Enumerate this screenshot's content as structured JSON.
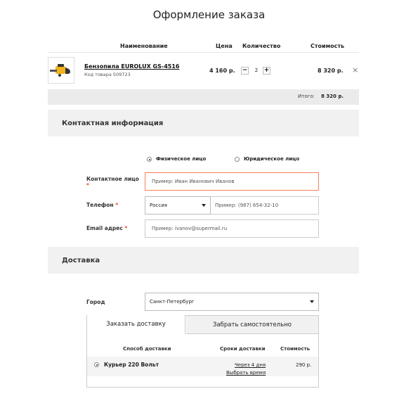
{
  "page": {
    "title": "Оформление заказа"
  },
  "cart": {
    "headers": {
      "name": "Наименование",
      "price": "Цена",
      "qty": "Количество",
      "cost": "Стоимость"
    },
    "items": [
      {
        "name": "Бензопила EUROLUX GS-4516",
        "code": "Код товара 509723",
        "price": "4 160 р.",
        "qty_minus": "−",
        "qty": "2",
        "qty_plus": "+",
        "total": "8 320 р.",
        "remove": "×"
      }
    ],
    "total_label": "Итого:",
    "total_value": "8 320 р."
  },
  "contact": {
    "title": "Контактная информация",
    "person_type": {
      "individual": "Физическое лицо",
      "legal": "Юридическое лицо",
      "selected": "individual"
    },
    "contact_person": {
      "label": "Контактное лицо",
      "req": "*",
      "placeholder": "Пример: Иван Иванович Иванов"
    },
    "phone": {
      "label": "Телефон",
      "req": "*",
      "country": "Россия",
      "placeholder": "Пример: (987) 654-32-10"
    },
    "email": {
      "label": "Email адрес",
      "req": "*",
      "placeholder": "Пример: ivanov@supermail.ru"
    }
  },
  "delivery": {
    "title": "Доставка",
    "city_label": "Город",
    "city_value": "Санкт-Петербург",
    "tabs": {
      "order_delivery": "Заказать доставку",
      "pickup": "Забрать самостоятельно",
      "active": "order_delivery"
    },
    "table_headers": {
      "method": "Способ доставки",
      "term": "Сроки доставки",
      "cost": "Стоимость"
    },
    "options": [
      {
        "name": "Курьер 220 Вольт",
        "term": "Через 4 дня",
        "choose_time": "Выбрать время",
        "cost": "290 р.",
        "selected": true
      }
    ]
  },
  "colors": {
    "accent_error": "#e8522f",
    "section_bg": "#f1f1f1"
  },
  "icons": {
    "remove": "close-icon",
    "dropdown": "chevron-down-icon",
    "product": "chainsaw-image"
  }
}
